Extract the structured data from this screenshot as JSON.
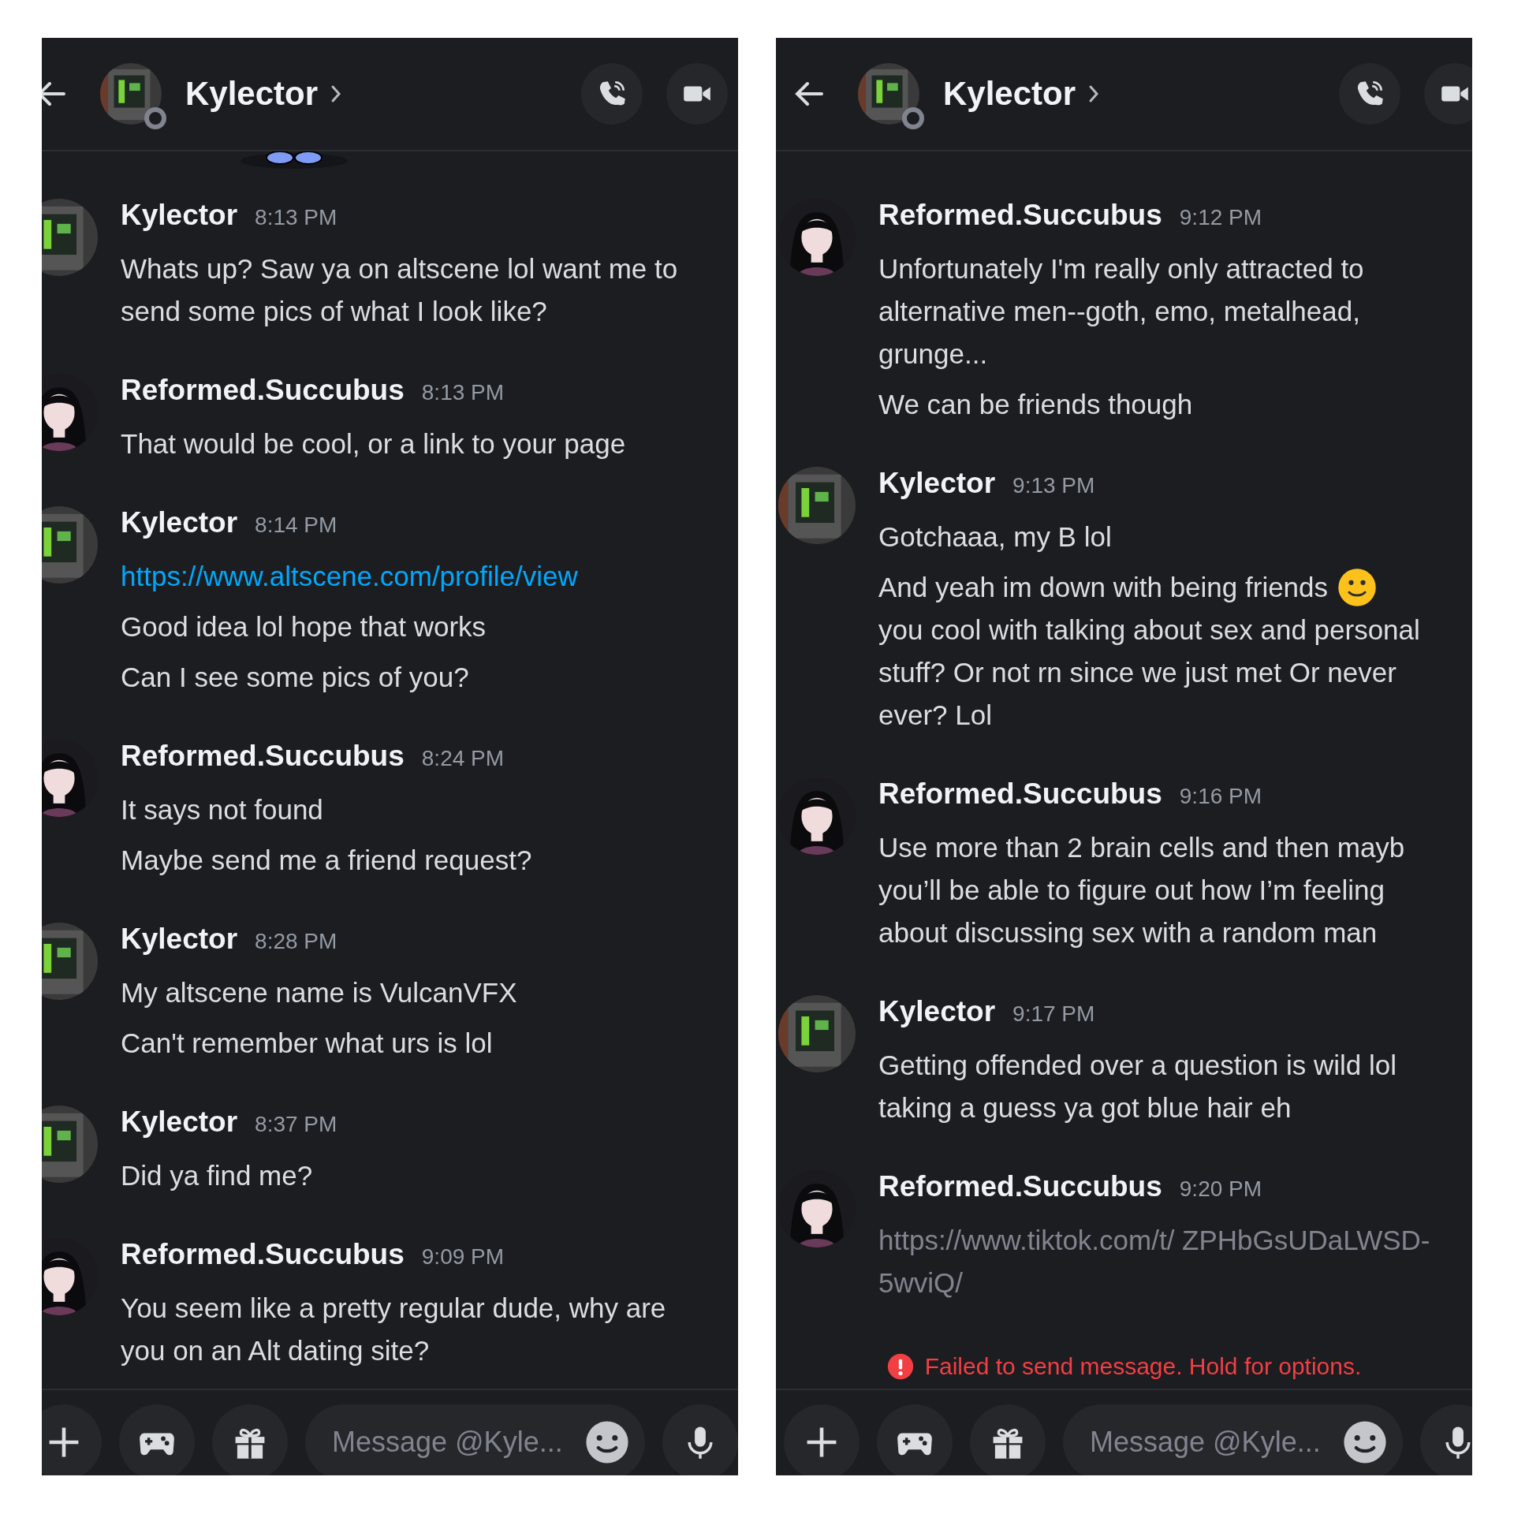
{
  "panels": [
    {
      "header": {
        "name": "Kylector",
        "status": {
          "kind": "offline"
        },
        "avatar": {
          "kind": "pc"
        }
      },
      "sticker_peek": true,
      "groups": [
        {
          "author": "Kylector",
          "avatar": {
            "kind": "pc"
          },
          "time": "8:13 PM",
          "messages": [
            {
              "kind": "text",
              "text": "Whats up? Saw ya on altscene lol want me to send some pics of what I look like?"
            }
          ]
        },
        {
          "author": "Reformed.Succubus",
          "avatar": {
            "kind": "figure"
          },
          "time": "8:13 PM",
          "messages": [
            {
              "kind": "text",
              "text": "That would be cool, or a link to your page"
            }
          ]
        },
        {
          "author": "Kylector",
          "avatar": {
            "kind": "pc"
          },
          "time": "8:14 PM",
          "messages": [
            {
              "kind": "link",
              "text": "https://www.altscene.com/profile/view"
            },
            {
              "kind": "text",
              "text": "Good idea lol hope that works"
            },
            {
              "kind": "text",
              "text": "Can I see some pics of you?"
            }
          ]
        },
        {
          "author": "Reformed.Succubus",
          "avatar": {
            "kind": "figure"
          },
          "time": "8:24 PM",
          "messages": [
            {
              "kind": "text",
              "text": "It says not found"
            },
            {
              "kind": "text",
              "text": "Maybe send me a friend request?"
            }
          ]
        },
        {
          "author": "Kylector",
          "avatar": {
            "kind": "pc"
          },
          "time": "8:28 PM",
          "messages": [
            {
              "kind": "text",
              "text": "My altscene name is VulcanVFX"
            },
            {
              "kind": "text",
              "text": "Can't remember what urs is lol"
            }
          ]
        },
        {
          "author": "Kylector",
          "avatar": {
            "kind": "pc"
          },
          "time": "8:37 PM",
          "messages": [
            {
              "kind": "text",
              "text": "Did ya find me?"
            }
          ]
        },
        {
          "author": "Reformed.Succubus",
          "avatar": {
            "kind": "figure"
          },
          "time": "9:09 PM",
          "messages": [
            {
              "kind": "text",
              "text": "You seem like a pretty regular dude, why are you on an Alt dating site?"
            }
          ]
        }
      ],
      "composer": {
        "placeholder": "Message @Kyle..."
      }
    },
    {
      "header": {
        "name": "Kylector",
        "status": {
          "kind": "offline"
        },
        "avatar": {
          "kind": "pc"
        }
      },
      "sticker_peek": false,
      "groups": [
        {
          "author": "Reformed.Succubus",
          "avatar": {
            "kind": "figure"
          },
          "time": "9:12 PM",
          "messages": [
            {
              "kind": "text",
              "text": "Unfortunately I'm really only attracted to alternative men--goth, emo, metalhead, grunge..."
            },
            {
              "kind": "text",
              "text": "We can be friends though"
            }
          ]
        },
        {
          "author": "Kylector",
          "avatar": {
            "kind": "pc"
          },
          "time": "9:13 PM",
          "messages": [
            {
              "kind": "text",
              "text": "Gotchaaa, my B lol"
            },
            {
              "kind": "text",
              "text": "And yeah im down with being friends",
              "smiley": true,
              "cont": "you cool with talking about sex and personal stuff? Or not rn since we just met Or never ever? Lol"
            }
          ]
        },
        {
          "author": "Reformed.Succubus",
          "avatar": {
            "kind": "figure"
          },
          "time": "9:16 PM",
          "messages": [
            {
              "kind": "text",
              "text": "Use more than 2 brain cells and then mayb you’ll be able to figure out how I’m feeling about discussing sex with a random man"
            }
          ]
        },
        {
          "author": "Kylector",
          "avatar": {
            "kind": "pc"
          },
          "time": "9:17 PM",
          "messages": [
            {
              "kind": "text",
              "text": "Getting offended over a question is wild lol taking a guess ya got blue hair eh"
            }
          ]
        },
        {
          "author": "Reformed.Succubus",
          "avatar": {
            "kind": "figure"
          },
          "time": "9:20 PM",
          "messages": [
            {
              "kind": "failed",
              "text": "https://www.tiktok.com/t/ ZPHbGsUDaLWSD-5wviQ/"
            }
          ]
        }
      ],
      "error": "Failed to send message. Hold for options.",
      "composer": {
        "placeholder": "Message @Kyle..."
      }
    }
  ]
}
